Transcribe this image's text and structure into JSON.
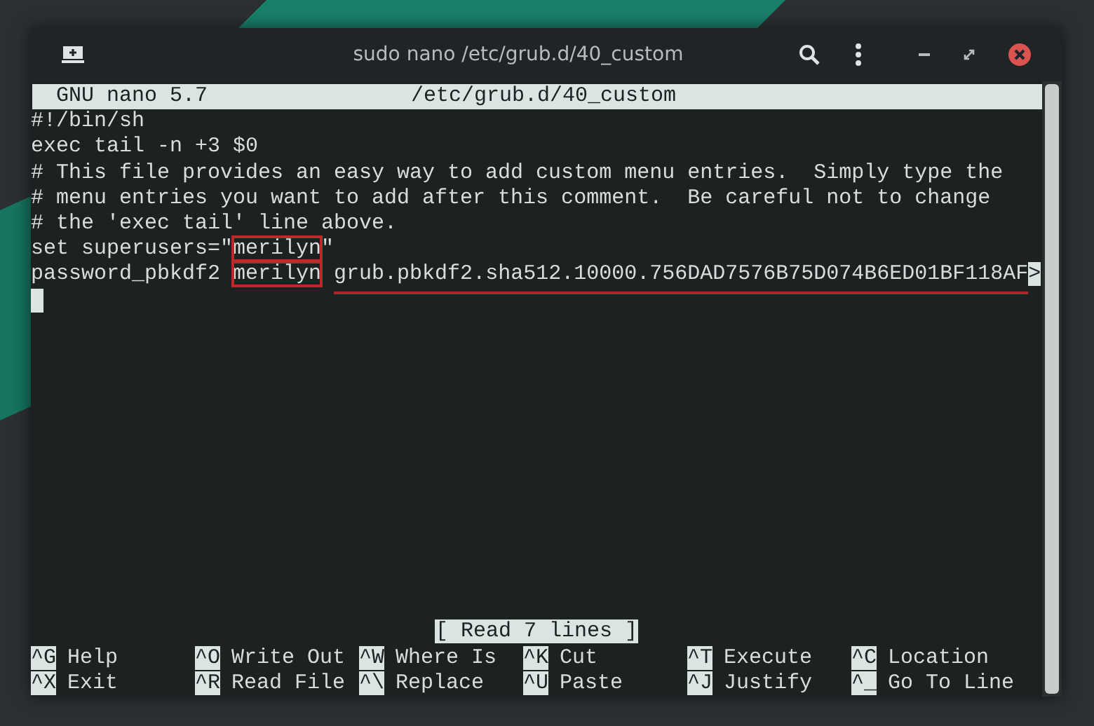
{
  "window": {
    "title": "sudo nano /etc/grub.d/40_custom"
  },
  "nano": {
    "version": "GNU nano 5.7",
    "filename": "/etc/grub.d/40_custom",
    "lines": [
      {
        "segments": [
          {
            "text": "#!/bin/sh",
            "kind": "plain"
          }
        ]
      },
      {
        "segments": [
          {
            "text": "exec tail -n +3 $0",
            "kind": "plain"
          }
        ]
      },
      {
        "segments": [
          {
            "text": "# This file provides an easy way to add custom menu entries.  Simply type the",
            "kind": "plain"
          }
        ]
      },
      {
        "segments": [
          {
            "text": "# menu entries you want to add after this comment.  Be careful not to change",
            "kind": "plain"
          }
        ]
      },
      {
        "segments": [
          {
            "text": "# the 'exec tail' line above.",
            "kind": "plain"
          }
        ]
      },
      {
        "segments": [
          {
            "text": "set superusers=\"",
            "kind": "plain"
          },
          {
            "text": "merilyn",
            "kind": "boxed"
          },
          {
            "text": "\"",
            "kind": "plain"
          }
        ]
      },
      {
        "segments": [
          {
            "text": "password_pbkdf2 ",
            "kind": "plain"
          },
          {
            "text": "merilyn",
            "kind": "boxed"
          },
          {
            "text": "grub.pbkdf2.sha512.10000.756DAD7576B75D074B6ED01BF118AF",
            "kind": "underlined"
          },
          {
            "text": ">",
            "kind": "marker"
          }
        ]
      }
    ],
    "status": "[ Read 7 lines ]",
    "shortcuts": [
      [
        {
          "key": "^G",
          "label": "Help"
        },
        {
          "key": "^X",
          "label": "Exit"
        }
      ],
      [
        {
          "key": "^O",
          "label": "Write Out"
        },
        {
          "key": "^R",
          "label": "Read File"
        }
      ],
      [
        {
          "key": "^W",
          "label": "Where Is"
        },
        {
          "key": "^\\",
          "label": "Replace"
        }
      ],
      [
        {
          "key": "^K",
          "label": "Cut"
        },
        {
          "key": "^U",
          "label": "Paste"
        }
      ],
      [
        {
          "key": "^T",
          "label": "Execute"
        },
        {
          "key": "^J",
          "label": "Justify"
        }
      ],
      [
        {
          "key": "^C",
          "label": "Location"
        },
        {
          "key": "^_",
          "label": "Go To Line"
        }
      ]
    ]
  }
}
